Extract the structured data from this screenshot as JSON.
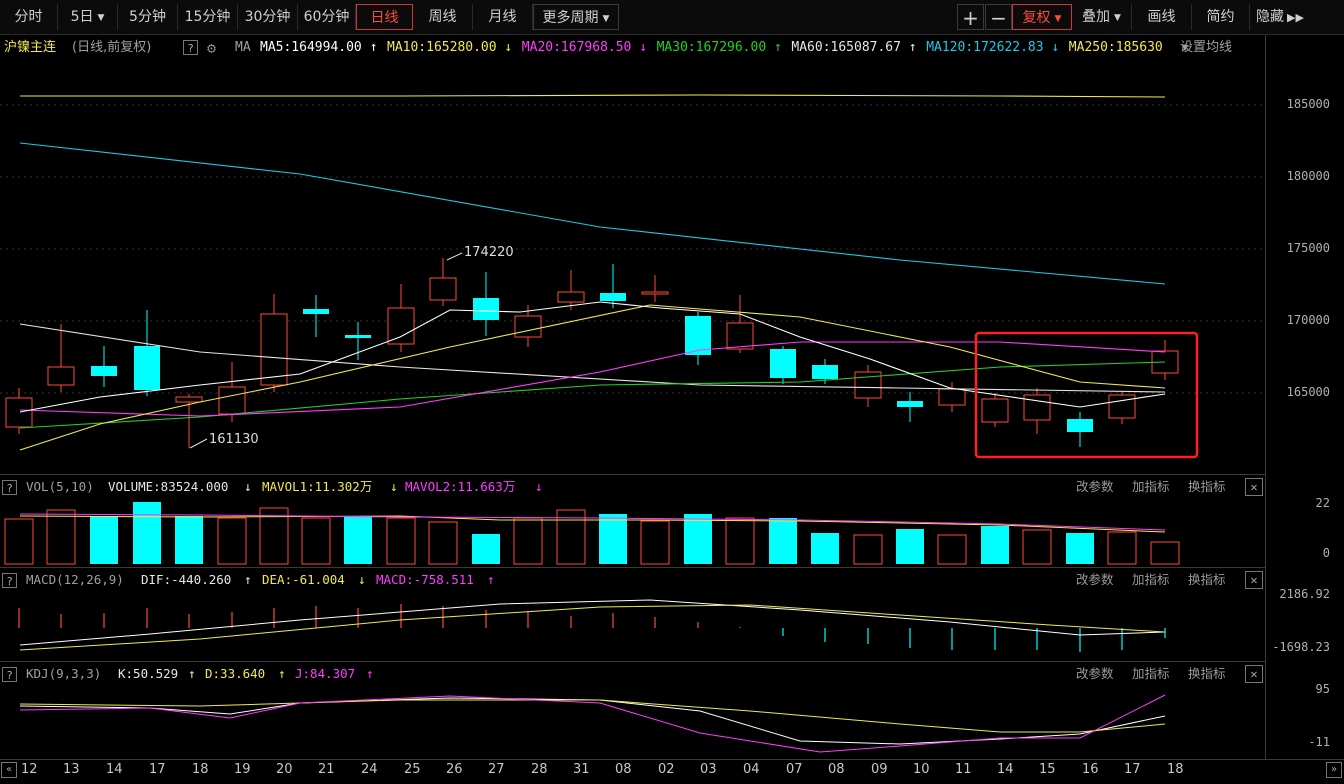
{
  "toolbar": {
    "periods": [
      "分时",
      "5日",
      "5分钟",
      "15分钟",
      "30分钟",
      "60分钟",
      "日线",
      "周线",
      "月线",
      "更多周期"
    ],
    "active_period": "日线",
    "plus_label": "+",
    "minus_label": "−",
    "fuquan_label": "复权",
    "diejia_label": "叠加",
    "huaxian_label": "画线",
    "jianyue_label": "简约",
    "yincang_label": "隐藏"
  },
  "main": {
    "instrument": "沪镍主连",
    "mode": "(日线,前复权)",
    "ma_label": "MA",
    "ma_items": [
      {
        "text": "MA5:164994.00",
        "arrow": "↑",
        "color": "#ffffff"
      },
      {
        "text": "MA10:165280.00",
        "arrow": "↓",
        "color": "#f2e94e"
      },
      {
        "text": "MA20:167968.50",
        "arrow": "↓",
        "color": "#ff3cff"
      },
      {
        "text": "MA30:167296.00",
        "arrow": "↑",
        "color": "#25d025"
      },
      {
        "text": "MA60:165087.67",
        "arrow": "↑",
        "color": "#e6e6e6"
      },
      {
        "text": "MA120:172622.83",
        "arrow": "↓",
        "color": "#1ec8e6"
      },
      {
        "text": "MA250:185630",
        "arrow": "",
        "color": "#f2e94e"
      }
    ],
    "settings_label": "设置均线",
    "price_axis": [
      "185000",
      "180000",
      "175000",
      "170000",
      "165000"
    ],
    "high_annotation": "174220",
    "low_annotation": "161130"
  },
  "vol": {
    "title": "VOL(5,10)",
    "volume": "VOLUME:83524.000",
    "volume_arrow": "↓",
    "mavol1": "MAVOL1:11.302万",
    "mavol1_arrow": "↓",
    "mavol2": "MAVOL2:11.663万",
    "mavol2_arrow": "↓",
    "axis": [
      "22",
      "0"
    ]
  },
  "macd": {
    "title": "MACD(12,26,9)",
    "dif": "DIF:-440.260",
    "dif_arrow": "↑",
    "dea": "DEA:-61.004",
    "dea_arrow": "↓",
    "macd": "MACD:-758.511",
    "macd_arrow": "↑",
    "axis": [
      "2186.92",
      "-1698.23"
    ]
  },
  "kdj": {
    "title": "KDJ(9,3,3)",
    "k": "K:50.529",
    "k_arrow": "↑",
    "d": "D:33.640",
    "d_arrow": "↑",
    "j": "J:84.307",
    "j_arrow": "↑",
    "axis": [
      "95",
      "-11"
    ]
  },
  "panel_actions": [
    "改参数",
    "加指标",
    "换指标"
  ],
  "dates": [
    "12",
    "13",
    "14",
    "17",
    "18",
    "19",
    "20",
    "21",
    "24",
    "25",
    "26",
    "27",
    "28",
    "31",
    "08",
    "02",
    "03",
    "04",
    "07",
    "08",
    "09",
    "10",
    "11",
    "14",
    "15",
    "16",
    "17",
    "18"
  ],
  "colors": {
    "up": "#ff4a3a",
    "down": "#00ffff",
    "highlight_box": "#ff2020"
  }
}
